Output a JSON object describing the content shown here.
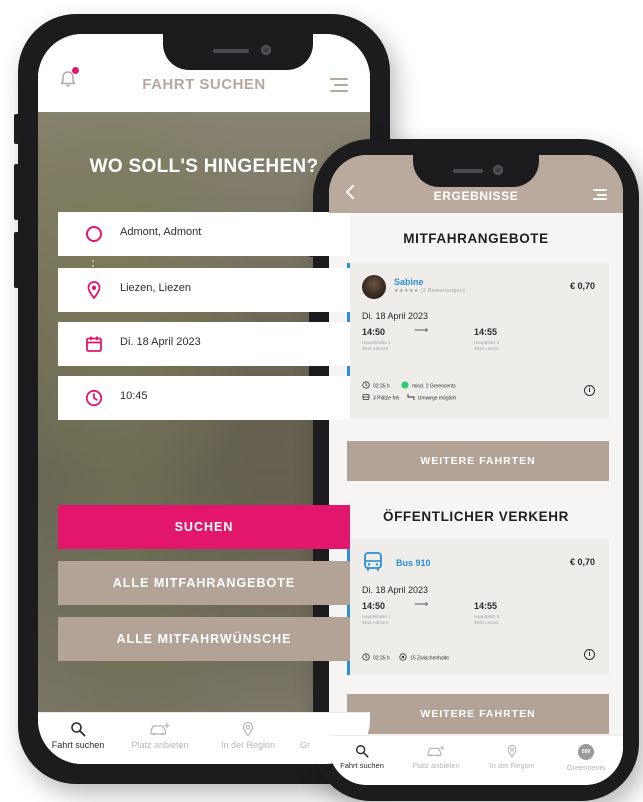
{
  "search_screen": {
    "header_title": "FAHRT SUCHEN",
    "heading": "WO SOLL'S HINGEHEN?",
    "from_value": "Admont, Admont",
    "to_value": "Liezen, Liezen",
    "date_value": "Di. 18 April 2023",
    "time_value": "10:45",
    "search_button": "SUCHEN",
    "all_offers_button": "ALLE MITFAHRANGEBOTE",
    "all_requests_button": "ALLE MITFAHRWÜNSCHE",
    "tabs": [
      {
        "label": "Fahrt suchen",
        "icon": "search-icon",
        "active": true
      },
      {
        "label": "Platz anbieten",
        "icon": "car-plus-icon",
        "active": false
      },
      {
        "label": "In der Region",
        "icon": "location-pin-icon",
        "active": false
      },
      {
        "label": "Gr",
        "icon": "greencents-icon",
        "active": false
      }
    ]
  },
  "results_screen": {
    "header_title": "ERGEBNISSE",
    "rideshare_section_title": "MITFAHRANGEBOTE",
    "rideshare_card": {
      "driver_name": "Sabine",
      "rating_text": "★★★★★  (2 Bewertungen)",
      "price": "€ 0,70",
      "date": "Di. 18 April 2023",
      "depart_time": "14:50",
      "arrive_time": "14:55",
      "depart_address": [
        "Hauptstraße 1",
        "8911 Admont"
      ],
      "arrive_address": [
        "Hauptplatz 3",
        "8940 Liezen"
      ],
      "duration": "02:25 h",
      "greencents": "mind. 2 Greencents",
      "seats": "3 Plätze frei",
      "detour": "Umwege möglich"
    },
    "more_rides_button_1": "WEITERE FAHRTEN",
    "public_section_title": "ÖFFENTLICHER VERKEHR",
    "bus_card": {
      "line": "Bus 910",
      "price": "€ 0,70",
      "date": "Di. 18 April 2023",
      "depart_time": "14:50",
      "arrive_time": "14:55",
      "depart_address": [
        "Hauptstraße 1",
        "8911 Admont"
      ],
      "arrive_address": [
        "Hauptplatz 3",
        "8940 Liezen"
      ],
      "duration": "02:25 h",
      "stops": "15 Zwischenhalte"
    },
    "more_rides_button_2": "WEITERE FAHRTEN",
    "tabs": [
      {
        "label": "Fahrt suchen",
        "icon": "search-icon",
        "active": true
      },
      {
        "label": "Platz anbieten",
        "icon": "car-plus-icon",
        "active": false
      },
      {
        "label": "In der Region",
        "icon": "location-pin-icon",
        "active": false
      },
      {
        "label": "Greencents",
        "icon": "greencents-icon",
        "badge": "599",
        "active": false
      }
    ]
  },
  "colors": {
    "accent_pink": "#e2166a",
    "taupe": "#b3a396",
    "link_blue": "#2b8fd6",
    "status_green": "#2ecc71"
  }
}
